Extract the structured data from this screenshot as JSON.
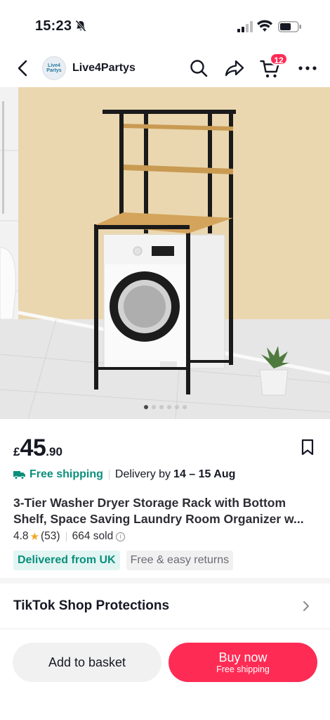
{
  "status_bar": {
    "time": "15:23",
    "icons": [
      "bell-slash-icon",
      "signal-icon",
      "wifi-icon",
      "battery-icon"
    ]
  },
  "nav": {
    "shop_name": "Live4Partys",
    "avatar_text": "Live4 Partys",
    "cart_count": "12",
    "icons": [
      "back-arrow-icon",
      "search-icon",
      "share-icon",
      "cart-icon",
      "more-icon"
    ]
  },
  "carousel": {
    "image_count": 6,
    "active_index": 0
  },
  "product": {
    "currency": "£",
    "price_whole": "45",
    "price_decimal": ".90",
    "free_shipping": "Free shipping",
    "delivery_label": "Delivery by",
    "delivery_dates": "14 – 15 Aug",
    "title_line1": "3-Tier Washer Dryer Storage Rack with Bottom",
    "title_line2": "Shelf, Space Saving Laundry Room Organizer w...",
    "rating": "4.8",
    "review_count": "(53)",
    "sold": "664 sold",
    "tags": [
      "Delivered from UK",
      "Free & easy returns"
    ]
  },
  "protections": {
    "label": "TikTok Shop Protections"
  },
  "actions": {
    "add_to_basket": "Add to basket",
    "buy_now": "Buy now",
    "buy_now_sub": "Free shipping"
  },
  "colors": {
    "accent": "#fe2c55",
    "teal": "#0a8f7b",
    "star": "#f5a623"
  }
}
